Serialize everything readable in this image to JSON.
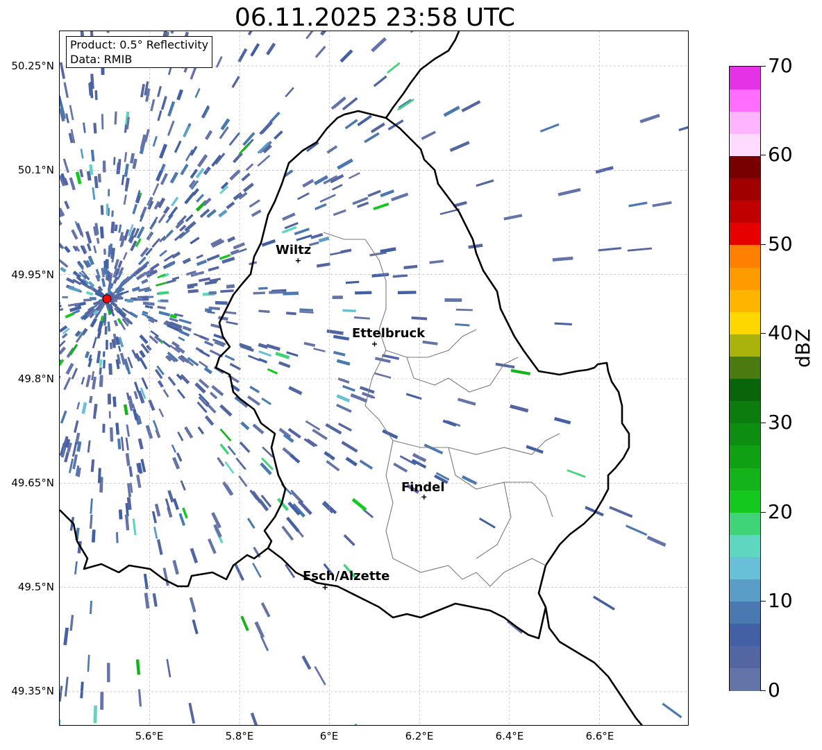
{
  "title": "06.11.2025 23:58 UTC",
  "info_box": {
    "product": "Product: 0.5° Reflectivity",
    "data": "Data: RMIB"
  },
  "axes": {
    "lat_ticks": [
      "50.25°N",
      "50.1°N",
      "49.95°N",
      "49.8°N",
      "49.65°N",
      "49.5°N",
      "49.35°N"
    ],
    "lon_ticks": [
      "5.6°E",
      "5.8°E",
      "6°E",
      "6.2°E",
      "6.4°E",
      "6.6°E"
    ],
    "lat_values": [
      50.25,
      50.1,
      49.95,
      49.8,
      49.65,
      49.5,
      49.35
    ],
    "lon_values": [
      5.6,
      5.8,
      6.0,
      6.2,
      6.4,
      6.6
    ],
    "lon_range": [
      5.4,
      6.8
    ],
    "lat_range": [
      49.3,
      50.3
    ]
  },
  "cities": [
    {
      "name": "Wiltz",
      "lon": 5.93,
      "lat": 49.97
    },
    {
      "name": "Ettelbruck",
      "lon": 6.1,
      "lat": 49.85
    },
    {
      "name": "Findel",
      "lon": 6.21,
      "lat": 49.63
    },
    {
      "name": "Esch/Alzette",
      "lon": 5.99,
      "lat": 49.5
    }
  ],
  "radar_site": {
    "lon": 5.505,
    "lat": 49.915,
    "color": "#ff0000"
  },
  "colorbar": {
    "unit": "dBZ",
    "range": [
      0,
      70
    ],
    "tick_labels": [
      "0",
      "10",
      "20",
      "30",
      "40",
      "50",
      "60",
      "70"
    ],
    "tick_values": [
      0,
      10,
      20,
      30,
      40,
      50,
      60,
      70
    ],
    "colors": [
      "#6473a8",
      "#5366a2",
      "#4360a4",
      "#4a78b0",
      "#5a9ec8",
      "#68c0d8",
      "#5fd6c0",
      "#3fd478",
      "#14c81e",
      "#12b41a",
      "#10a014",
      "#0e8e10",
      "#0c7c0e",
      "#0a640a",
      "#4a7a10",
      "#aab20c",
      "#ffd700",
      "#ffb400",
      "#ff9b00",
      "#ff8000",
      "#e60000",
      "#c00000",
      "#a00000",
      "#780000",
      "#ffdcff",
      "#ffb4ff",
      "#ff6eff",
      "#e632e6"
    ]
  }
}
